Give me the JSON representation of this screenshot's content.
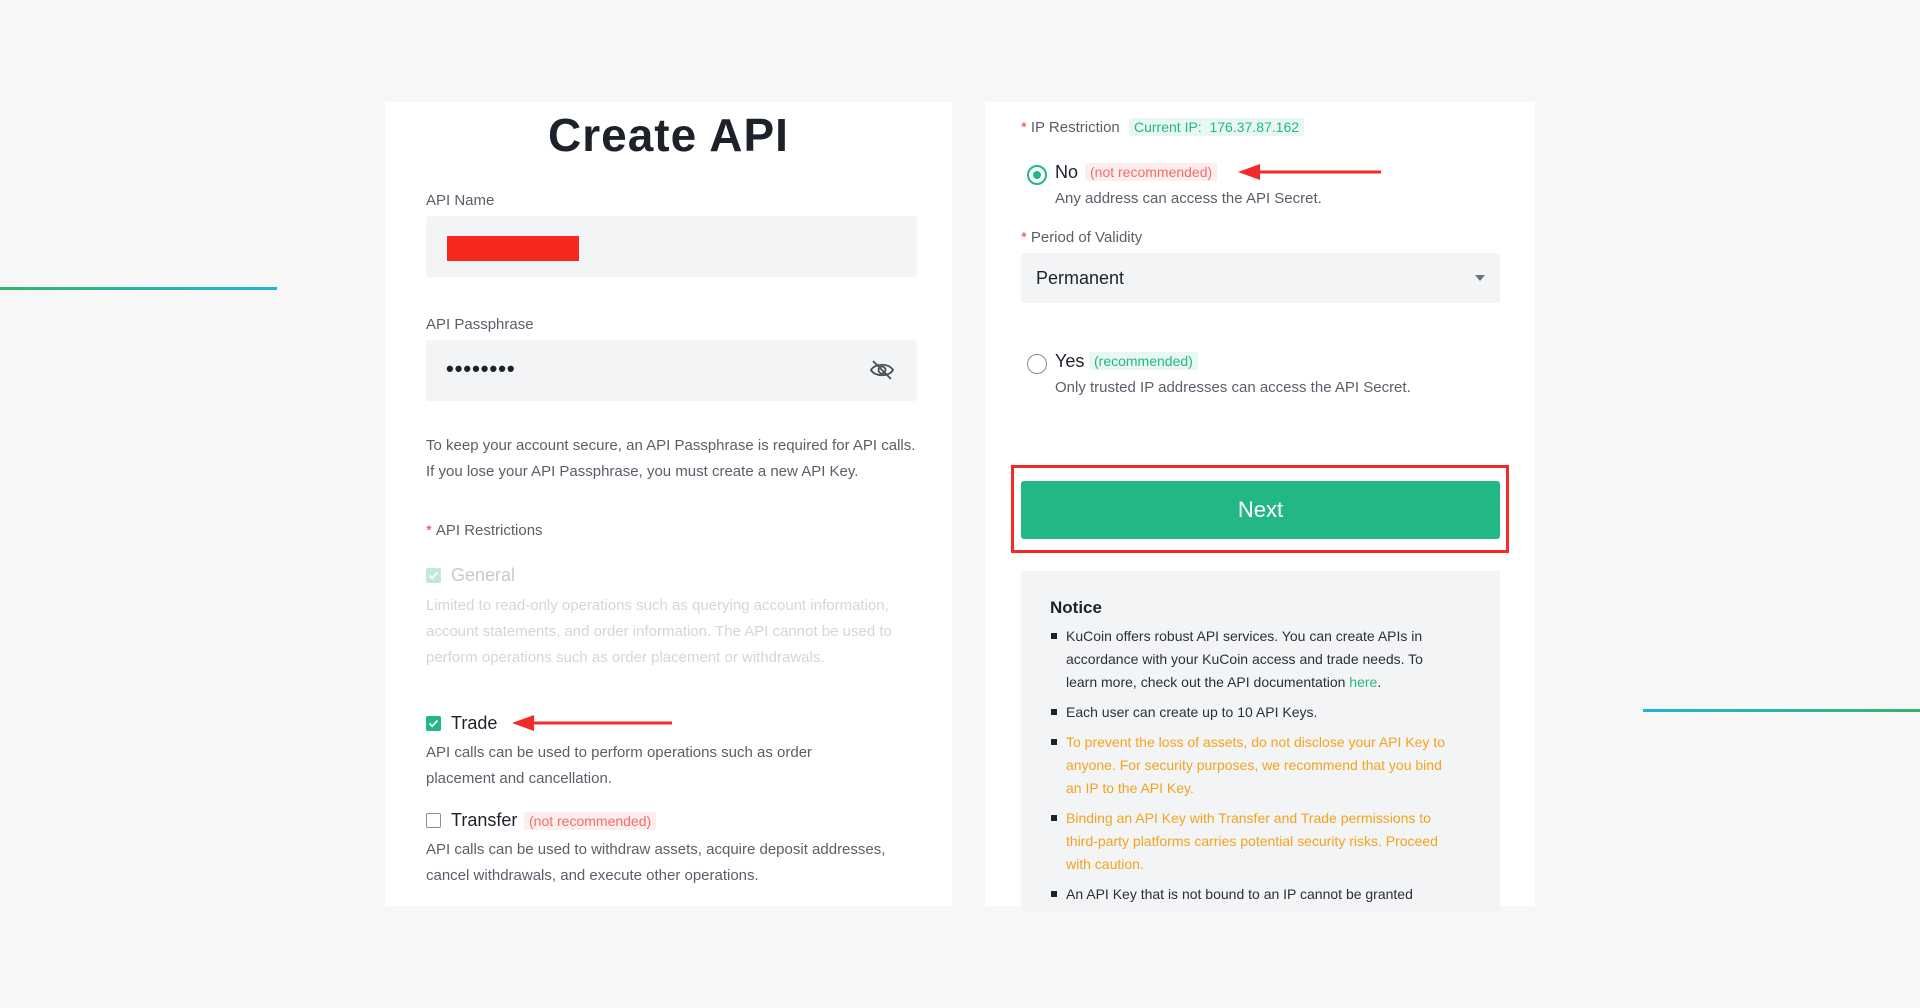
{
  "page": {
    "title": "Create API"
  },
  "form": {
    "api_name": {
      "label": "API Name"
    },
    "api_passphrase": {
      "label": "API Passphrase",
      "masked_value": "••••••••"
    },
    "passphrase_help": "To keep your account secure, an API Passphrase is required for API calls. If you lose your API Passphrase, you must create a new API Key.",
    "restrictions": {
      "required_mark": "*",
      "label": "API Restrictions",
      "options": [
        {
          "title": "General",
          "checked": true,
          "disabled": true,
          "description": "Limited to read-only operations such as querying account information, account statements, and order information. The API cannot be used to perform operations such as order placement or withdrawals."
        },
        {
          "title": "Trade",
          "checked": true,
          "disabled": false,
          "description": "API calls can be used to perform operations such as order placement and cancellation."
        },
        {
          "title": "Transfer",
          "checked": false,
          "disabled": false,
          "tag": "(not recommended)",
          "description": "API calls can be used to withdraw assets, acquire deposit addresses, cancel withdrawals, and execute other operations."
        }
      ]
    },
    "ip_restriction": {
      "required_mark": "*",
      "label": "IP Restriction",
      "current_ip_label": "Current IP:",
      "current_ip": "176.37.87.162",
      "options": [
        {
          "title": "No",
          "tag": "(not recommended)",
          "selected": true,
          "description": "Any address can access the API Secret."
        },
        {
          "title": "Yes",
          "tag": "(recommended)",
          "selected": false,
          "description": "Only trusted IP addresses can access the API Secret."
        }
      ]
    },
    "validity": {
      "required_mark": "*",
      "label": "Period of Validity",
      "value": "Permanent"
    },
    "next_label": "Next"
  },
  "notice": {
    "title": "Notice",
    "items": [
      {
        "text": "KuCoin offers robust API services. You can create APIs in accordance with your KuCoin access and trade needs. To learn more, check out the API documentation ",
        "link": "here",
        "suffix": ".",
        "warning": false
      },
      {
        "text": "Each user can create up to 10 API Keys.",
        "warning": false
      },
      {
        "text": "To prevent the loss of assets, do not disclose your API Key to anyone. For security purposes, we recommend that you bind an IP to the API Key.",
        "warning": true
      },
      {
        "text": "Binding an API Key with Transfer and Trade permissions to third-party platforms carries potential security risks. Proceed with caution.",
        "warning": true
      },
      {
        "text": "An API Key that is not bound to an IP cannot be granted",
        "warning": false
      }
    ]
  },
  "colors": {
    "accent": "#23b786",
    "danger": "#f32a2a",
    "warning": "#f4a31d",
    "background": "#f7f7f7"
  }
}
